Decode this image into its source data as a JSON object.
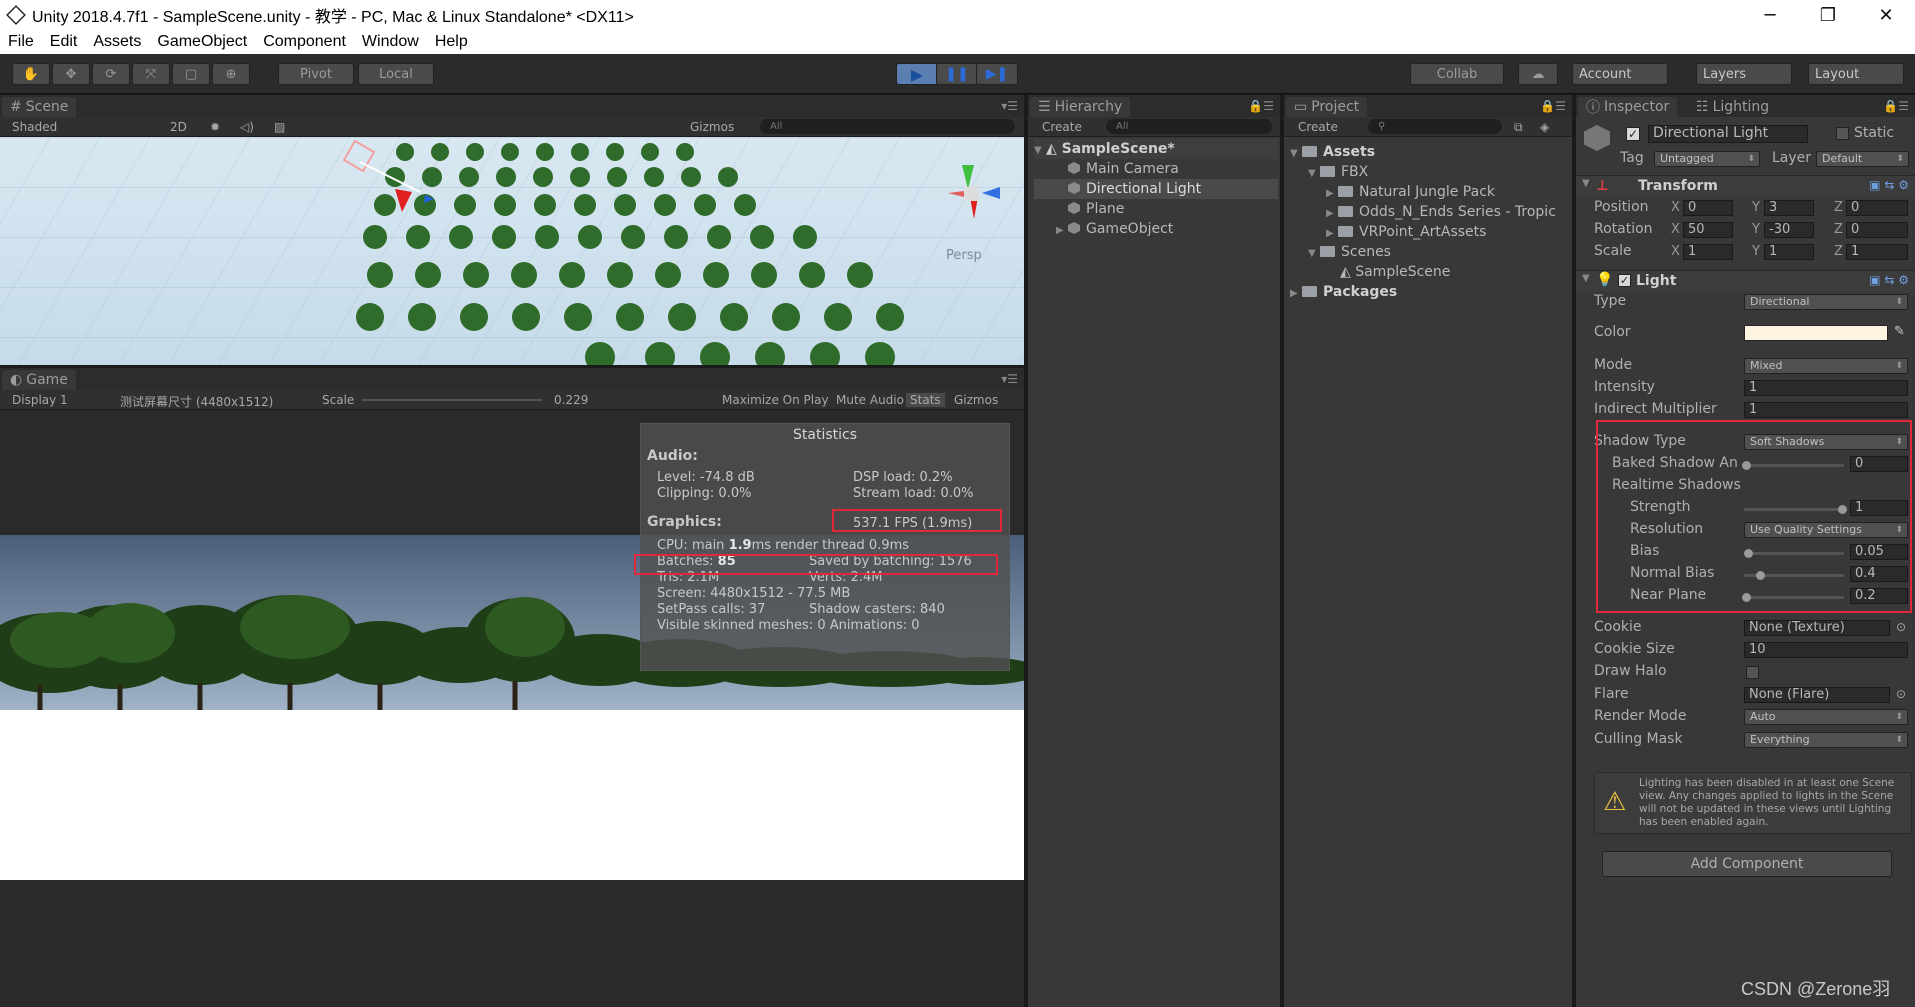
{
  "window": {
    "title": "Unity 2018.4.7f1 - SampleScene.unity - 教学 - PC, Mac & Linux Standalone* <DX11>",
    "minimize": "─",
    "maximize": "❐",
    "close": "✕"
  },
  "menu": [
    "File",
    "Edit",
    "Assets",
    "GameObject",
    "Component",
    "Window",
    "Help"
  ],
  "toolbar": {
    "pivot": "Pivot",
    "local": "Local",
    "collab": "Collab",
    "account": "Account",
    "layers": "Layers",
    "layout": "Layout"
  },
  "scene": {
    "tab": "Scene",
    "shading": "Shaded",
    "mode2d": "2D",
    "gizmos": "Gizmos",
    "search": "All",
    "persp": "Persp"
  },
  "game": {
    "tab": "Game",
    "display": "Display 1",
    "resolution": "测试屏幕尺寸 (4480x1512)",
    "scale_label": "Scale",
    "scale_value": "0.229",
    "maximize": "Maximize On Play",
    "mute": "Mute Audio",
    "stats": "Stats",
    "gizmos": "Gizmos"
  },
  "statistics": {
    "title": "Statistics",
    "audio": "Audio:",
    "level": "Level: -74.8 dB",
    "clipping": "Clipping: 0.0%",
    "dsp": "DSP load: 0.2%",
    "stream": "Stream load: 0.0%",
    "graphics": "Graphics:",
    "fps": "537.1 FPS (1.9ms)",
    "cpu_a": "CPU: main ",
    "cpu_b": "1.9",
    "cpu_c": "ms  render thread 0.9ms",
    "batches_a": "Batches: ",
    "batches_b": "85",
    "saved": "Saved by batching: 1576",
    "tris": "Tris: 2.1M",
    "verts": "Verts: 2.4M",
    "screen": "Screen: 4480x1512 - 77.5 MB",
    "setpass": "SetPass calls: 37",
    "shadow": "Shadow casters: 840",
    "skinned": "Visible skinned meshes: 0  Animations: 0"
  },
  "hierarchy": {
    "tab": "Hierarchy",
    "create": "Create",
    "search": "All",
    "scene": "SampleScene*",
    "items": [
      "Main Camera",
      "Directional Light",
      "Plane",
      "GameObject"
    ]
  },
  "project": {
    "tab": "Project",
    "create": "Create",
    "assets": "Assets",
    "fbx": "FBX",
    "fbx_items": [
      "Natural Jungle Pack",
      "Odds_N_Ends Series - Tropic",
      "VRPoint_ArtAssets"
    ],
    "scenes": "Scenes",
    "scene_file": "SampleScene",
    "packages": "Packages"
  },
  "inspector": {
    "tab": "Inspector",
    "tab2": "Lighting",
    "object_name": "Directional Light",
    "static": "Static",
    "tag_label": "Tag",
    "tag": "Untagged",
    "layer_label": "Layer",
    "layer": "Default",
    "transform": "Transform",
    "position": "Position",
    "rotation": "Rotation",
    "scale": "Scale",
    "pos": [
      "0",
      "3",
      "0"
    ],
    "rot": [
      "50",
      "-30",
      "0"
    ],
    "scl": [
      "1",
      "1",
      "1"
    ],
    "light": "Light",
    "type_label": "Type",
    "type": "Directional",
    "color_label": "Color",
    "color": "#fdf3e1",
    "mode_label": "Mode",
    "mode": "Mixed",
    "intensity_label": "Intensity",
    "intensity": "1",
    "indirect_label": "Indirect Multiplier",
    "indirect": "1",
    "shadow_type_label": "Shadow Type",
    "shadow_type": "Soft Shadows",
    "baked_label": "Baked Shadow An",
    "baked": "0",
    "realtime": "Realtime Shadows",
    "strength_label": "Strength",
    "strength": "1",
    "resolution_label": "Resolution",
    "resolution": "Use Quality Settings",
    "bias_label": "Bias",
    "bias": "0.05",
    "normal_label": "Normal Bias",
    "normal": "0.4",
    "near_label": "Near Plane",
    "near": "0.2",
    "cookie_label": "Cookie",
    "cookie": "None (Texture)",
    "cookie_size_label": "Cookie Size",
    "cookie_size": "10",
    "halo_label": "Draw Halo",
    "flare_label": "Flare",
    "flare": "None (Flare)",
    "render_label": "Render Mode",
    "render": "Auto",
    "culling_label": "Culling Mask",
    "culling": "Everything",
    "warning": "Lighting has been disabled in at least one Scene view. Any changes applied to lights in the Scene will not be updated in these views until Lighting has been enabled again.",
    "add_component": "Add Component"
  },
  "watermark": "CSDN @Zerone羽"
}
